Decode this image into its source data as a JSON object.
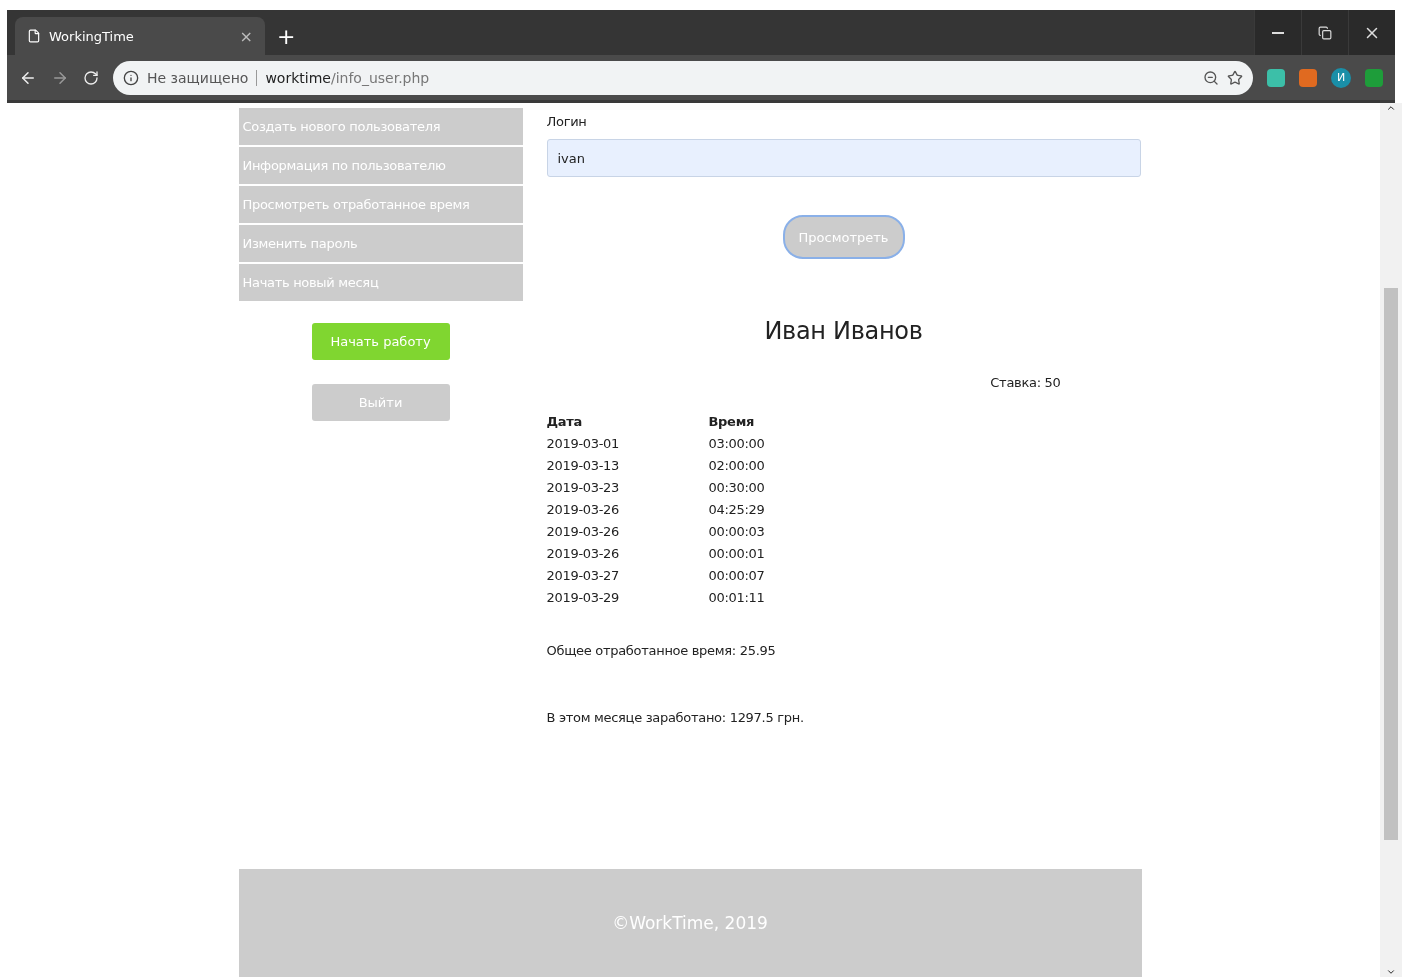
{
  "browser": {
    "tab": {
      "title": "WorkingTime",
      "close": "×",
      "new_tab": "+"
    },
    "address": {
      "security": "Не защищено",
      "host": "worktime",
      "path": "/info_user.php"
    },
    "profile_initial": "И"
  },
  "sidebar": {
    "items": [
      {
        "label": "Создать нового пользователя"
      },
      {
        "label": "Информация по пользователю"
      },
      {
        "label": "Просмотреть отработанное время"
      },
      {
        "label": "Изменить пароль"
      },
      {
        "label": "Начать новый месяц"
      }
    ],
    "buttons": [
      {
        "label": "Начать работу",
        "kind": "primary"
      },
      {
        "label": "Выйти",
        "kind": "secondary"
      }
    ]
  },
  "form": {
    "label": "Логин",
    "value": "ivan",
    "button": "Просмотреть"
  },
  "user": {
    "name": "Иван Иванов",
    "rate": "Ставка: 50"
  },
  "table": {
    "columns": [
      "Дата",
      "Время"
    ],
    "rows": [
      [
        "2019-03-01",
        "03:00:00"
      ],
      [
        "2019-03-13",
        "02:00:00"
      ],
      [
        "2019-03-23",
        "00:30:00"
      ],
      [
        "2019-03-26",
        "04:25:29"
      ],
      [
        "2019-03-26",
        "00:00:03"
      ],
      [
        "2019-03-26",
        "00:00:01"
      ],
      [
        "2019-03-27",
        "00:00:07"
      ],
      [
        "2019-03-29",
        "00:01:11"
      ]
    ]
  },
  "total": "Общее отработанное время: 25.95",
  "earned": "В этом месяце заработано: 1297.5 грн.",
  "footer": "©WorkTime, 2019"
}
